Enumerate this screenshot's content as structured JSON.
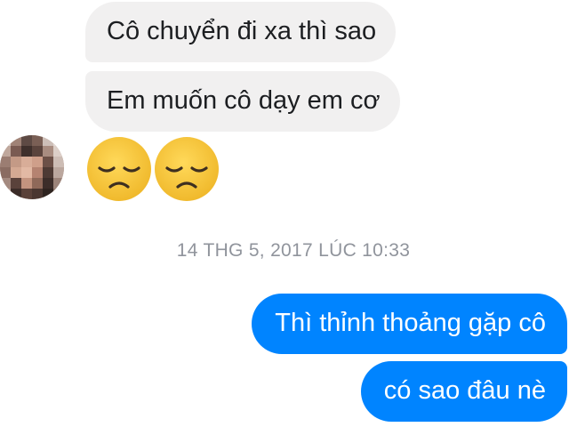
{
  "conversation": {
    "received": [
      {
        "text": "Cô chuyển đi xa thì sao"
      },
      {
        "text": "Em muốn cô dạy em cơ"
      }
    ],
    "emojis": [
      "disappointed-face",
      "disappointed-face"
    ],
    "timestamp": "14 THG 5, 2017 LÚC 10:33",
    "sent": [
      {
        "text": "Thì thỉnh thoảng gặp cô"
      },
      {
        "text": "có sao đâu nè"
      }
    ]
  },
  "colors": {
    "sent_bubble": "#0084ff",
    "received_bubble": "#f1f0f0",
    "timestamp_text": "#90949c",
    "emoji_face": "#f6c43b"
  }
}
